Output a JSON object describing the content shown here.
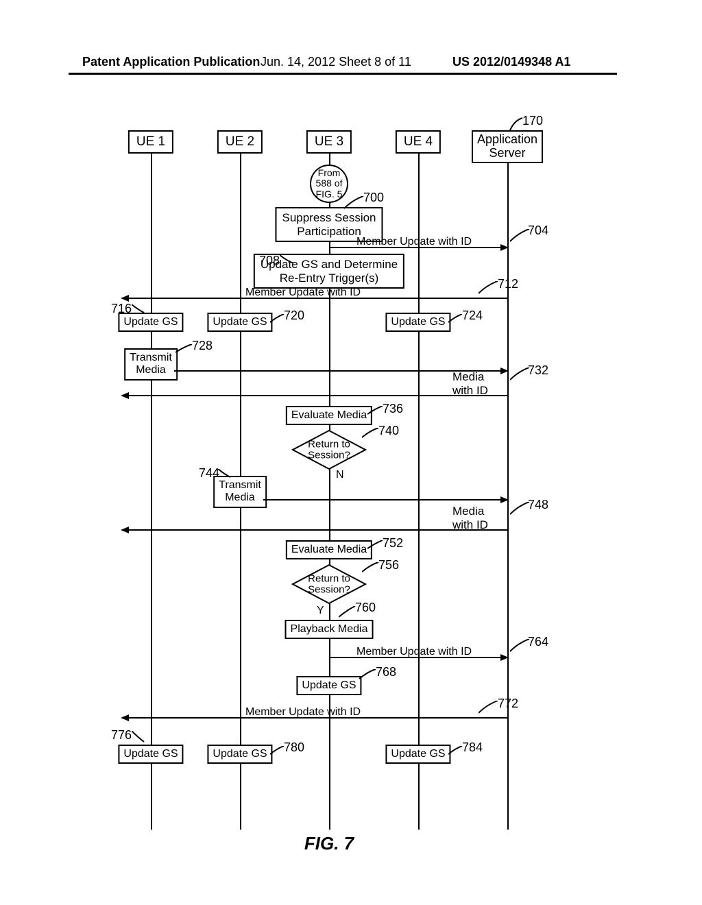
{
  "header": {
    "left": "Patent Application Publication",
    "mid": "Jun. 14, 2012  Sheet 8 of 11",
    "right": "US 2012/0149348 A1"
  },
  "participants": {
    "ue1": "UE 1",
    "ue2": "UE 2",
    "ue3": "UE 3",
    "ue4": "UE 4",
    "app": "Application\nServer"
  },
  "refs": {
    "r170": "170",
    "r700": "700",
    "r704": "704",
    "r708": "708",
    "r712": "712",
    "r716": "716",
    "r720": "720",
    "r724": "724",
    "r728": "728",
    "r732": "732",
    "r736": "736",
    "r740": "740",
    "r744": "744",
    "r748": "748",
    "r752": "752",
    "r756": "756",
    "r760": "760",
    "r764": "764",
    "r768": "768",
    "r772": "772",
    "r776": "776",
    "r780": "780",
    "r784": "784"
  },
  "connector": "From\n588 of\nFIG. 5",
  "boxes": {
    "suppress": "Suppress Session\nParticipation",
    "update_reentry": "Update GS and Determine\nRe-Entry Trigger(s)",
    "update_gs": "Update GS",
    "transmit_media": "Transmit\nMedia",
    "evaluate_media": "Evaluate Media",
    "playback_media": "Playback Media"
  },
  "decisions": {
    "return_session": "Return to\nSession?",
    "n": "N",
    "y": "Y"
  },
  "arrows": {
    "member_update": "Member Update with ID",
    "media_with_id": "Media\nwith ID"
  },
  "figure": "FIG. 7",
  "chart_data": {
    "type": "sequence-diagram",
    "participants": [
      "UE 1",
      "UE 2",
      "UE 3",
      "UE 4",
      "Application Server"
    ],
    "title": "FIG. 7",
    "start": {
      "ref": "From 588 of FIG. 5",
      "at": "UE 3"
    },
    "steps": [
      {
        "ref": 700,
        "at": "UE 3",
        "type": "process",
        "text": "Suppress Session Participation"
      },
      {
        "ref": 704,
        "type": "message",
        "from": "UE 3",
        "to": "Application Server",
        "text": "Member Update with ID"
      },
      {
        "ref": 708,
        "at": "UE 3",
        "type": "process",
        "text": "Update GS and Determine Re-Entry Trigger(s)"
      },
      {
        "ref": 712,
        "type": "message",
        "from": "Application Server",
        "to": [
          "UE 1",
          "UE 2",
          "UE 3",
          "UE 4"
        ],
        "text": "Member Update with ID"
      },
      {
        "ref": 716,
        "at": "UE 1",
        "type": "process",
        "text": "Update GS"
      },
      {
        "ref": 720,
        "at": "UE 2",
        "type": "process",
        "text": "Update GS"
      },
      {
        "ref": 724,
        "at": "UE 4",
        "type": "process",
        "text": "Update GS"
      },
      {
        "ref": 728,
        "at": "UE 1",
        "type": "process",
        "text": "Transmit Media",
        "arrowTo": "Application Server"
      },
      {
        "ref": 732,
        "type": "message",
        "from": "Application Server",
        "to": [
          "UE 1",
          "UE 2",
          "UE 3",
          "UE 4"
        ],
        "text": "Media with ID"
      },
      {
        "ref": 736,
        "at": "UE 3",
        "type": "process",
        "text": "Evaluate Media"
      },
      {
        "ref": 740,
        "at": "UE 3",
        "type": "decision",
        "text": "Return to Session?",
        "result": "N"
      },
      {
        "ref": 744,
        "at": "UE 2",
        "type": "process",
        "text": "Transmit Media",
        "arrowTo": "Application Server"
      },
      {
        "ref": 748,
        "type": "message",
        "from": "Application Server",
        "to": [
          "UE 1",
          "UE 2",
          "UE 3",
          "UE 4"
        ],
        "text": "Media with ID"
      },
      {
        "ref": 752,
        "at": "UE 3",
        "type": "process",
        "text": "Evaluate Media"
      },
      {
        "ref": 756,
        "at": "UE 3",
        "type": "decision",
        "text": "Return to Session?",
        "result": "Y"
      },
      {
        "ref": 760,
        "at": "UE 3",
        "type": "process",
        "text": "Playback Media"
      },
      {
        "ref": 764,
        "type": "message",
        "from": "UE 3",
        "to": "Application Server",
        "text": "Member Update with ID"
      },
      {
        "ref": 768,
        "at": "UE 3",
        "type": "process",
        "text": "Update GS"
      },
      {
        "ref": 772,
        "type": "message",
        "from": "Application Server",
        "to": [
          "UE 1",
          "UE 2",
          "UE 3",
          "UE 4"
        ],
        "text": "Member Update with ID"
      },
      {
        "ref": 776,
        "at": "UE 1",
        "type": "process",
        "text": "Update GS"
      },
      {
        "ref": 780,
        "at": "UE 2",
        "type": "process",
        "text": "Update GS"
      },
      {
        "ref": 784,
        "at": "UE 4",
        "type": "process",
        "text": "Update GS"
      }
    ]
  }
}
